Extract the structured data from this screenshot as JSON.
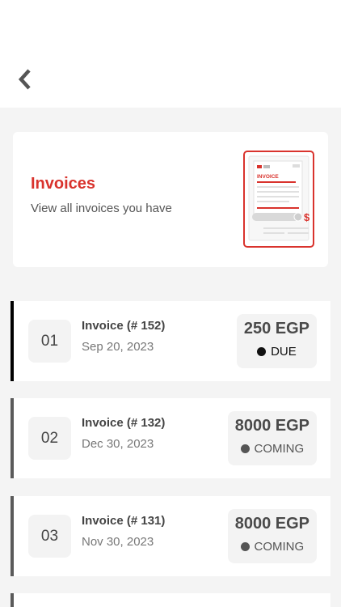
{
  "nav": {
    "back_icon": "chevron-left-icon"
  },
  "header": {
    "title": "Invoices",
    "subtitle": "View all invoices you have",
    "illustration": {
      "doc_title": "INVOICE",
      "currency_symbol": "$",
      "brand_red": "#d9332d"
    }
  },
  "invoices": [
    {
      "index": "01",
      "title": "Invoice (# 152)",
      "date": "Sep 20, 2023",
      "amount": "250 EGP",
      "status": "DUE",
      "status_color": "#111111",
      "accent_color": "#000000"
    },
    {
      "index": "02",
      "title": "Invoice (# 132)",
      "date": "Dec 30, 2023",
      "amount": "8000 EGP",
      "status": "COMING",
      "status_color": "#555555",
      "accent_color": "#5a5a5a"
    },
    {
      "index": "03",
      "title": "Invoice (# 131)",
      "date": "Nov 30, 2023",
      "amount": "8000 EGP",
      "status": "COMING",
      "status_color": "#555555",
      "accent_color": "#5a5a5a"
    }
  ]
}
